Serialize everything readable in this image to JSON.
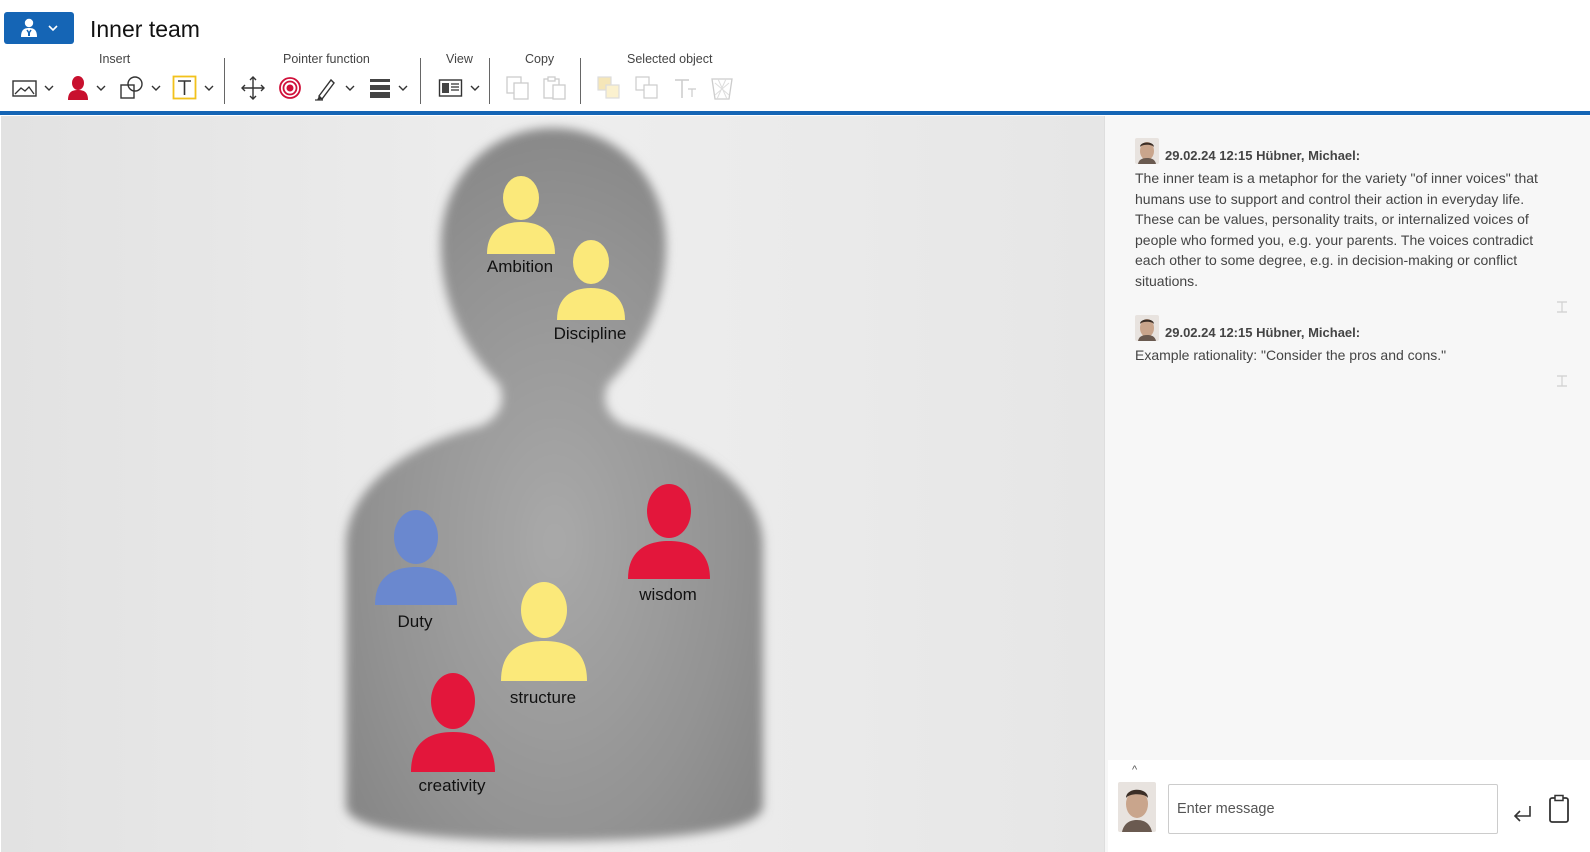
{
  "header": {
    "title": "Inner team",
    "user_menu_icon": "user-icon",
    "accent": "#1565b5"
  },
  "ribbon": {
    "groups": {
      "insert": "Insert",
      "pointer": "Pointer function",
      "view": "View",
      "copy": "Copy",
      "selected": "Selected object"
    },
    "tools": [
      "image-icon",
      "person-icon",
      "shapes-icon",
      "text-icon",
      "move-icon",
      "pointer-target-icon",
      "pen-icon",
      "line-style-icon",
      "view-icon",
      "copy-icon",
      "paste-icon",
      "bring-front-icon",
      "send-back-icon",
      "text-format-icon",
      "delete-icon"
    ]
  },
  "canvas": {
    "figures": [
      {
        "label": "Ambition",
        "color": "#fbe97a"
      },
      {
        "label": "Discipline",
        "color": "#fbe97a"
      },
      {
        "label": "wisdom",
        "color": "#e3163b"
      },
      {
        "label": "Duty",
        "color": "#6a88cf"
      },
      {
        "label": "structure",
        "color": "#fbe97a"
      },
      {
        "label": "creativity",
        "color": "#e3163b"
      }
    ]
  },
  "chat": {
    "messages": [
      {
        "meta": "29.02.24 12:15 Hübner, Michael:",
        "text": "The inner team is a metaphor for the variety \"of inner voices\" that humans use to support and control their action in everyday life. These can be values, personality traits, or internalized voices of people who formed you, e.g. your parents. The voices contradict each other to some degree, e.g. in decision-making or conflict situations."
      },
      {
        "meta": "29.02.24 12:15 Hübner, Michael:",
        "text": "Example rationality: \"Consider the pros and cons.\""
      }
    ],
    "composer": {
      "placeholder": "Enter message",
      "collapse": "^"
    }
  }
}
